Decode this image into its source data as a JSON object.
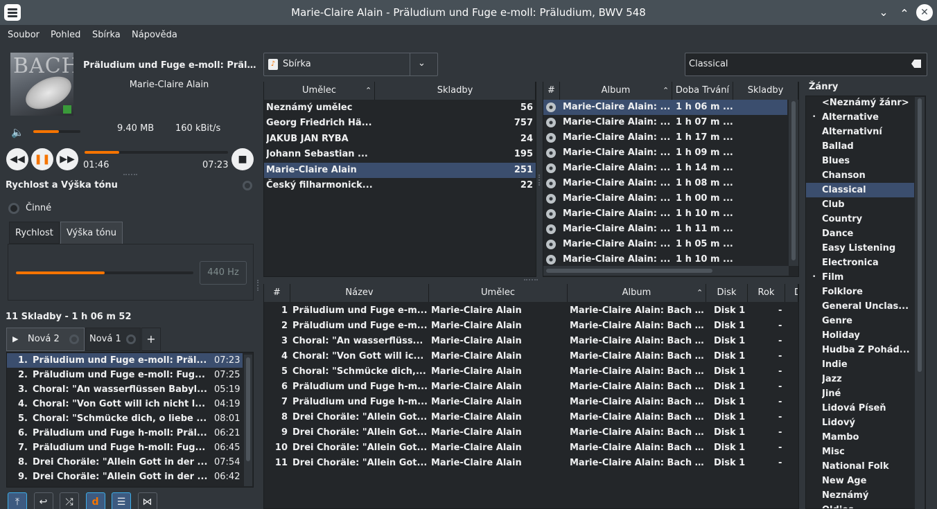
{
  "window": {
    "title": "Marie-Claire Alain - Präludium und Fuge e-moll: Präludium, BWV 548",
    "minimize_icon": "chevron-down-icon",
    "maximize_icon": "chevron-up-icon",
    "close_icon": "close-icon"
  },
  "menu": [
    "Soubor",
    "Pohled",
    "Sbírka",
    "Nápověda"
  ],
  "now_playing": {
    "title": "Präludium und Fuge e-moll: Präludium",
    "artist": "Marie-Claire Alain",
    "file_size": "9.40 MB",
    "bitrate": "160 kBit/s",
    "volume_fraction": 0.55,
    "elapsed": "01:46",
    "total": "07:23",
    "progress_fraction": 0.24
  },
  "transport": {
    "prev_icon": "previous-icon",
    "pause_icon": "pause-icon",
    "next_icon": "next-icon",
    "stop_icon": "stop-icon"
  },
  "speed_pitch": {
    "heading": "Rychlost a Výška tónu",
    "enabled_label": "Činné",
    "tabs": [
      "Rychlost",
      "Výška tónu"
    ],
    "active_tab": 1,
    "slider_fraction": 0.5,
    "pitch_value": "440 Hz"
  },
  "playlist": {
    "summary": "11 Skladby - 1 h 06 m 52",
    "tabs": [
      "Nová 2",
      "Nová 1"
    ],
    "add_tab_label": "+",
    "items": [
      {
        "num": "1.",
        "title": "Präludium und Fuge e-moll: Präl...",
        "time": "07:23"
      },
      {
        "num": "2.",
        "title": "Präludium und Fuge e-moll: Fug...",
        "time": "07:25"
      },
      {
        "num": "3.",
        "title": "Choral: \"An wasserflüssen Babyl...",
        "time": "05:19"
      },
      {
        "num": "4.",
        "title": "Choral: \"Von Gott will ich nicht l...",
        "time": "04:19"
      },
      {
        "num": "5.",
        "title": "Choral: \"Schmücke dich, o liebe ...",
        "time": "08:01"
      },
      {
        "num": "6.",
        "title": "Präludium und Fuge h-moll: Präl...",
        "time": "06:21"
      },
      {
        "num": "7.",
        "title": "Präludium und Fuge h-moll: Fug...",
        "time": "06:45"
      },
      {
        "num": "8.",
        "title": "Drei Choräle: \"Allein Gott in der ...",
        "time": "07:54"
      },
      {
        "num": "9.",
        "title": "Drei Choräle: \"Allein Gott in der ...",
        "time": "06:42"
      }
    ]
  },
  "collection": {
    "source_label": "Sbírka",
    "search_value": "Classical",
    "clear_icon": "clear-icon",
    "artists_headers": [
      "Umělec",
      "Skladby"
    ],
    "artists": [
      {
        "name": "Neznámý umělec",
        "count": "56"
      },
      {
        "name": "Georg Friedrich Hä...",
        "count": "757"
      },
      {
        "name": "JAKUB JAN RYBA",
        "count": "24"
      },
      {
        "name": "Johann Sebastian ...",
        "count": "195"
      },
      {
        "name": "Marie-Claire Alain",
        "count": "251"
      },
      {
        "name": "Český filharmonick...",
        "count": "22"
      }
    ],
    "selected_artist": 4,
    "albums_headers": [
      "#",
      "Album",
      "Doba Trvání",
      "Skladby"
    ],
    "albums": [
      {
        "name": "Marie-Claire Alain: ...",
        "duration": "1 h 06 m ..."
      },
      {
        "name": "Marie-Claire Alain: ...",
        "duration": "1 h 07 m ..."
      },
      {
        "name": "Marie-Claire Alain: ...",
        "duration": "1 h 17 m ..."
      },
      {
        "name": "Marie-Claire Alain: ...",
        "duration": "1 h 09 m ..."
      },
      {
        "name": "Marie-Claire Alain: ...",
        "duration": "1 h 14 m ..."
      },
      {
        "name": "Marie-Claire Alain: ...",
        "duration": "1 h 08 m ..."
      },
      {
        "name": "Marie-Claire Alain: ...",
        "duration": "1 h 00 m ..."
      },
      {
        "name": "Marie-Claire Alain: ...",
        "duration": "1 h 10 m ..."
      },
      {
        "name": "Marie-Claire Alain: ...",
        "duration": "1 h 11 m ..."
      },
      {
        "name": "Marie-Claire Alain: ...",
        "duration": "1 h 05 m ..."
      },
      {
        "name": "Marie-Claire Alain: ...",
        "duration": "1 h 10 m ..."
      }
    ],
    "selected_album": 0,
    "tracks_headers": [
      "#",
      "Název",
      "Umělec",
      "Album",
      "Disk",
      "Rok",
      "D"
    ],
    "tracks": [
      {
        "num": "1",
        "title": "Präludium und Fuge e-m...",
        "artist": "Marie-Claire Alain",
        "album": "Marie-Claire Alain: Bach ...",
        "disk": "Disk 1",
        "year": "-"
      },
      {
        "num": "2",
        "title": "Präludium und Fuge e-m...",
        "artist": "Marie-Claire Alain",
        "album": "Marie-Claire Alain: Bach ...",
        "disk": "Disk 1",
        "year": "-"
      },
      {
        "num": "3",
        "title": "Choral: \"An wasserflüss...",
        "artist": "Marie-Claire Alain",
        "album": "Marie-Claire Alain: Bach ...",
        "disk": "Disk 1",
        "year": "-"
      },
      {
        "num": "4",
        "title": "Choral: \"Von Gott will ic...",
        "artist": "Marie-Claire Alain",
        "album": "Marie-Claire Alain: Bach ...",
        "disk": "Disk 1",
        "year": "-"
      },
      {
        "num": "5",
        "title": "Choral: \"Schmücke dich,...",
        "artist": "Marie-Claire Alain",
        "album": "Marie-Claire Alain: Bach ...",
        "disk": "Disk 1",
        "year": "-"
      },
      {
        "num": "6",
        "title": "Präludium und Fuge h-m...",
        "artist": "Marie-Claire Alain",
        "album": "Marie-Claire Alain: Bach ...",
        "disk": "Disk 1",
        "year": "-"
      },
      {
        "num": "7",
        "title": "Präludium und Fuge h-m...",
        "artist": "Marie-Claire Alain",
        "album": "Marie-Claire Alain: Bach ...",
        "disk": "Disk 1",
        "year": "-"
      },
      {
        "num": "8",
        "title": "Drei Choräle: \"Allein Got...",
        "artist": "Marie-Claire Alain",
        "album": "Marie-Claire Alain: Bach ...",
        "disk": "Disk 1",
        "year": "-"
      },
      {
        "num": "9",
        "title": "Drei Choräle: \"Allein Got...",
        "artist": "Marie-Claire Alain",
        "album": "Marie-Claire Alain: Bach ...",
        "disk": "Disk 1",
        "year": "-"
      },
      {
        "num": "10",
        "title": "Drei Choräle: \"Allein Got...",
        "artist": "Marie-Claire Alain",
        "album": "Marie-Claire Alain: Bach ...",
        "disk": "Disk 1",
        "year": "-"
      },
      {
        "num": "11",
        "title": "Drei Choräle: \"Allein Got...",
        "artist": "Marie-Claire Alain",
        "album": "Marie-Claire Alain: Bach ...",
        "disk": "Disk 1",
        "year": "-"
      }
    ]
  },
  "genres": {
    "heading": "Žánry",
    "items": [
      "<Neznámý žánr>",
      "Alternative",
      "Alternativní",
      "Ballad",
      "Blues",
      "Chanson",
      "Classical",
      "Club",
      "Country",
      "Dance",
      "Easy Listening",
      "Electronica",
      "Film",
      "Folklore",
      "General Unclas...",
      "Genre",
      "Holiday",
      "Hudba Z Pohád...",
      "Indie",
      "Jazz",
      "Jiné",
      "Lidová Píseň",
      "Lidový",
      "Mambo",
      "Misc",
      "National Folk",
      "New Age",
      "Neznámý",
      "Oldies"
    ],
    "selected": "Classical",
    "bulleted": [
      "Alternative",
      "Film"
    ]
  },
  "bottom_toolbar": [
    "repeat-one-icon",
    "repeat-icon",
    "shuffle-icon",
    "dynamic-icon",
    "playlist-icon",
    "equalizer-icon"
  ],
  "colors": {
    "accent": "#f67400",
    "selection": "#3b4e6e",
    "background": "#31363b",
    "panel": "#232629"
  }
}
